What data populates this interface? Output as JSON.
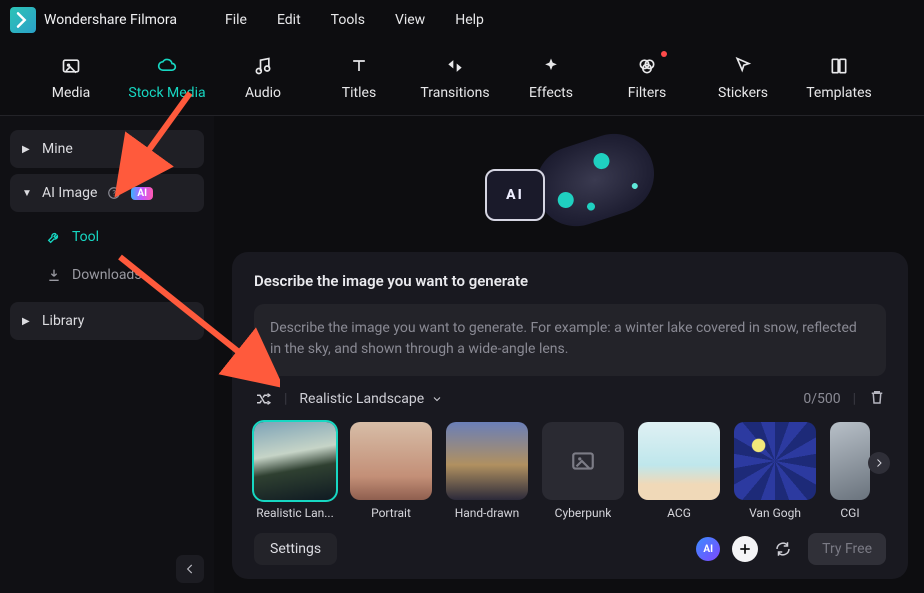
{
  "app": {
    "name": "Wondershare Filmora"
  },
  "menubar": [
    "File",
    "Edit",
    "Tools",
    "View",
    "Help"
  ],
  "tabs": [
    {
      "label": "Media"
    },
    {
      "label": "Stock Media",
      "active": true
    },
    {
      "label": "Audio"
    },
    {
      "label": "Titles"
    },
    {
      "label": "Transitions"
    },
    {
      "label": "Effects"
    },
    {
      "label": "Filters",
      "dot": true
    },
    {
      "label": "Stickers"
    },
    {
      "label": "Templates"
    }
  ],
  "sidebar": {
    "mine": "Mine",
    "aiimage": "AI Image",
    "ai_badge": "AI",
    "tool": "Tool",
    "downloads": "Downloads",
    "library": "Library"
  },
  "panel": {
    "title": "Describe the image you want to generate",
    "placeholder": "Describe the image you want to generate. For example: a winter lake covered in snow, reflected in the sky, and shown through a wide-angle lens.",
    "style_selected": "Realistic Landscape",
    "counter": "0/500",
    "styles": [
      {
        "label": "Realistic Lan...",
        "selected": true
      },
      {
        "label": "Portrait"
      },
      {
        "label": "Hand-drawn"
      },
      {
        "label": "Cyberpunk",
        "empty": true
      },
      {
        "label": "ACG"
      },
      {
        "label": "Van Gogh"
      },
      {
        "label": "CGI"
      }
    ],
    "settings_label": "Settings",
    "ai_chip": "AI",
    "try_free": "Try Free"
  },
  "hero_ai": "AI"
}
